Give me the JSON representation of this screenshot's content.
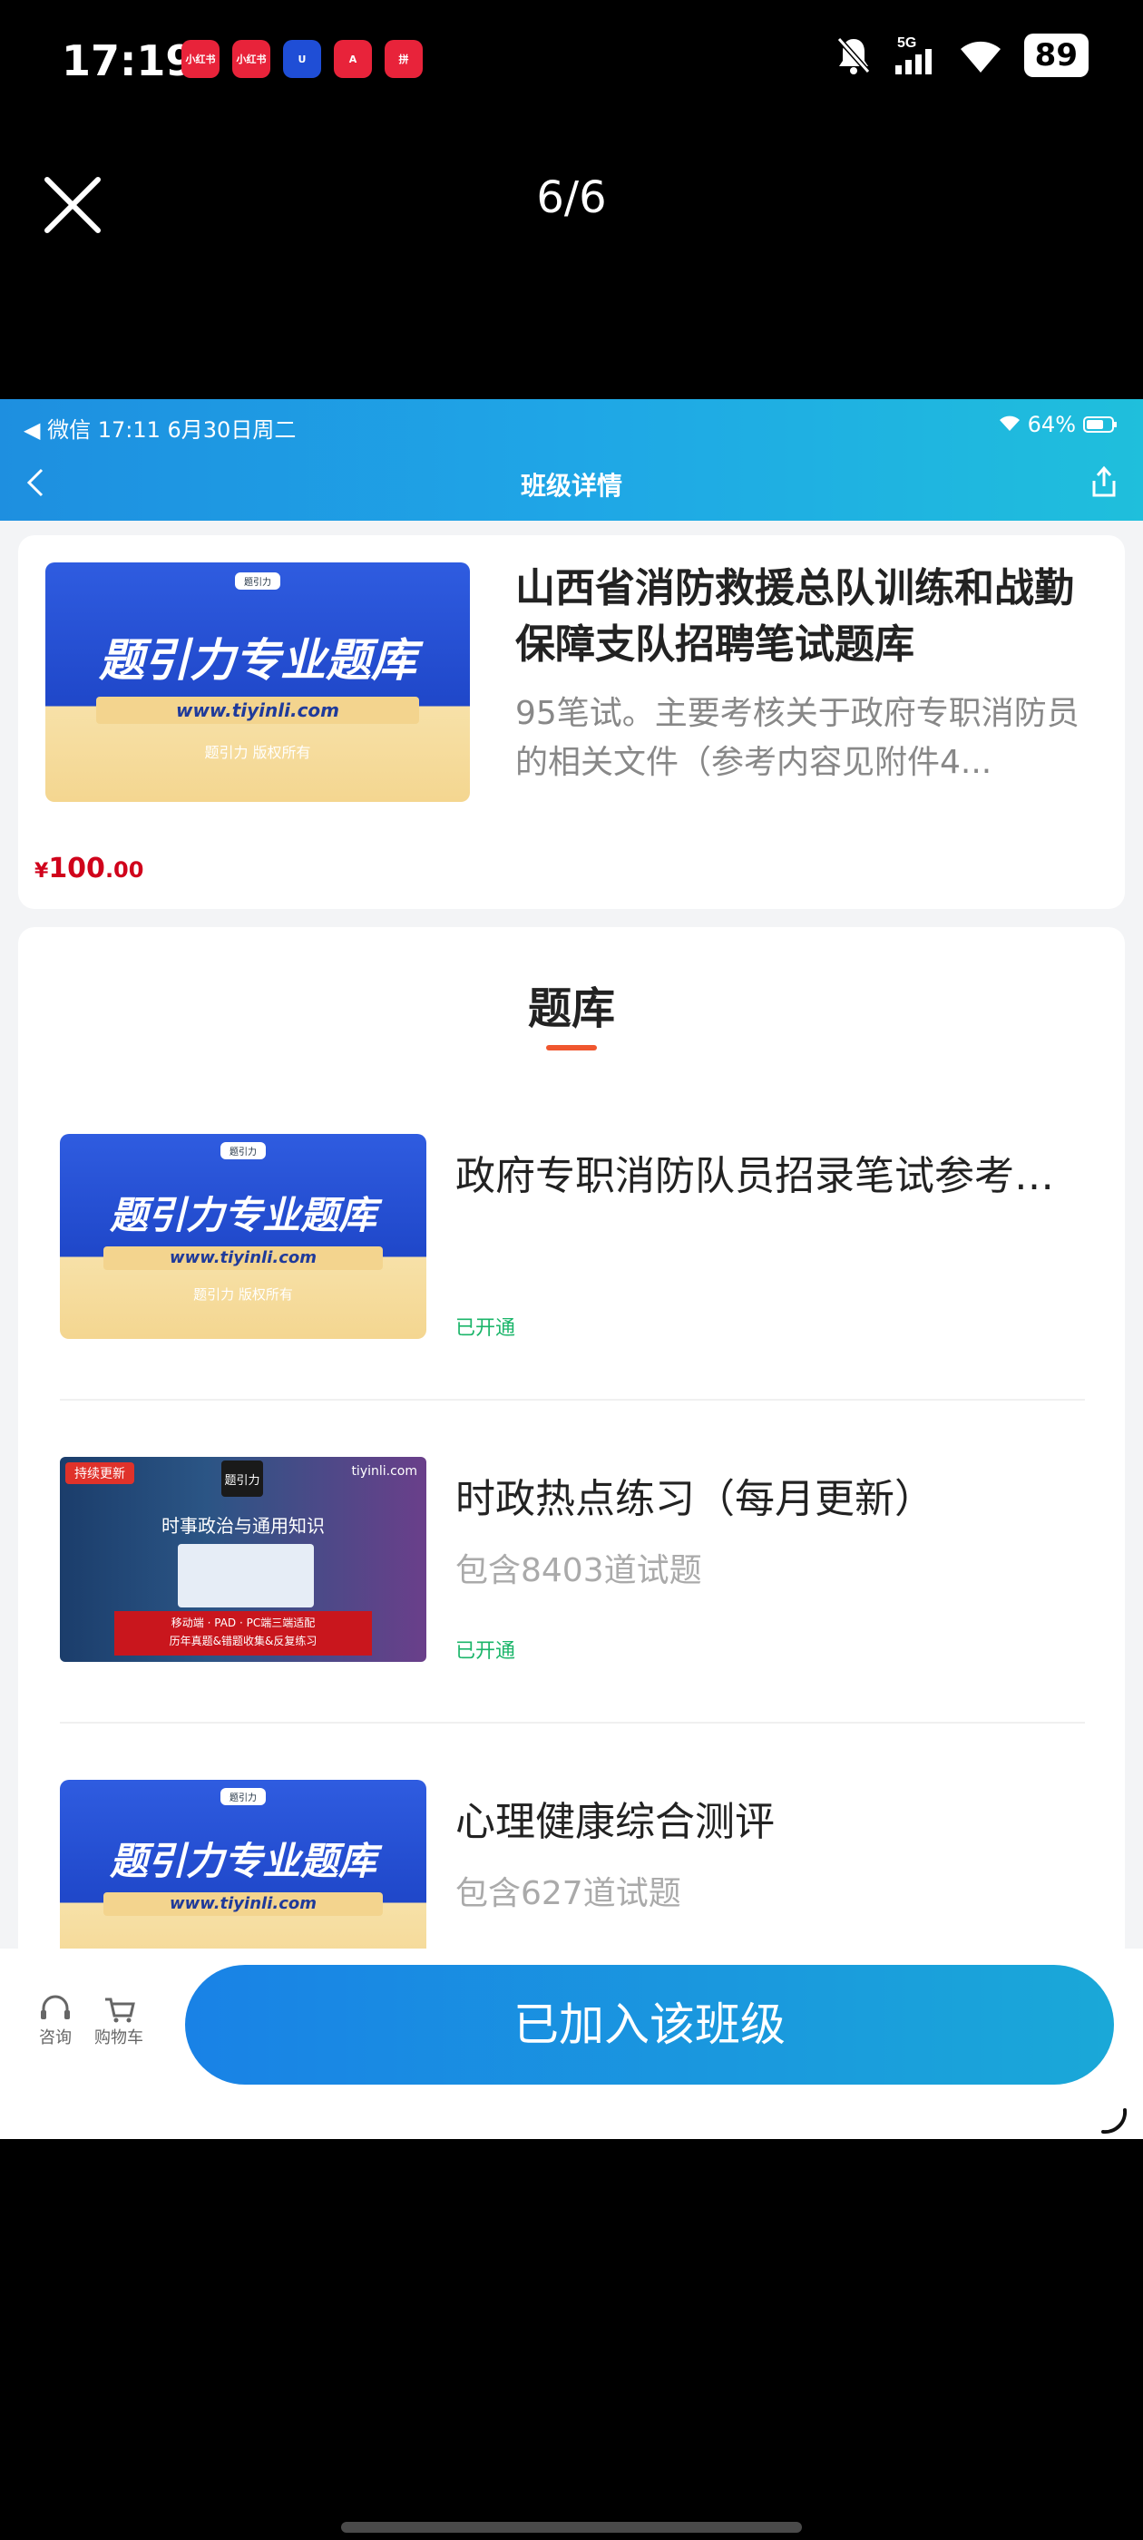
{
  "phone_status": {
    "time": "17:19",
    "battery": "89",
    "signal": "5G",
    "apps": [
      {
        "label": "小红书",
        "color": "#e8233a"
      },
      {
        "label": "小红书",
        "color": "#e8233a"
      },
      {
        "label": "U",
        "color": "#1f4ed6"
      },
      {
        "label": "A",
        "color": "#e8233a"
      },
      {
        "label": "拼",
        "color": "#e8233a"
      }
    ]
  },
  "viewer": {
    "counter": "6/6"
  },
  "inner_status": {
    "left": "◀ 微信   17:11   6月30日周二",
    "battery": "64%"
  },
  "header": {
    "title": "班级详情"
  },
  "course": {
    "title": "山西省消防救援总队训练和战勤保障支队招聘笔试题库",
    "description": "95笔试。主要考核关于政府专职消防员的相关文件（参考内容见附件4...",
    "price": {
      "currency": "¥",
      "integer": "100",
      "decimal": ".00"
    },
    "cover": {
      "logo": "题引力",
      "headline": "题引力专业题库",
      "url": "www.tiyinli.com",
      "copyright": "题引力 版权所有"
    }
  },
  "bank": {
    "title": "题库",
    "items": [
      {
        "name": "政府专职消防队员招录笔试参考题库",
        "count": "",
        "status": "已开通"
      },
      {
        "name": "时政热点练习（每月更新）",
        "count": "包含8403道试题",
        "status": "已开通",
        "thumb": {
          "tag": "持续更新",
          "brand": "题引力",
          "site": "tiyinli.com",
          "headline": "时事政治与通用知识",
          "line1": "移动端 · PAD · PC端三端适配",
          "line2": "历年真题&错题收集&反复练习"
        }
      },
      {
        "name": "心理健康综合测评",
        "count": "包含627道试题",
        "status": ""
      }
    ]
  },
  "bottom": {
    "consult": "咨询",
    "cart": "购物车",
    "join": "已加入该班级"
  }
}
